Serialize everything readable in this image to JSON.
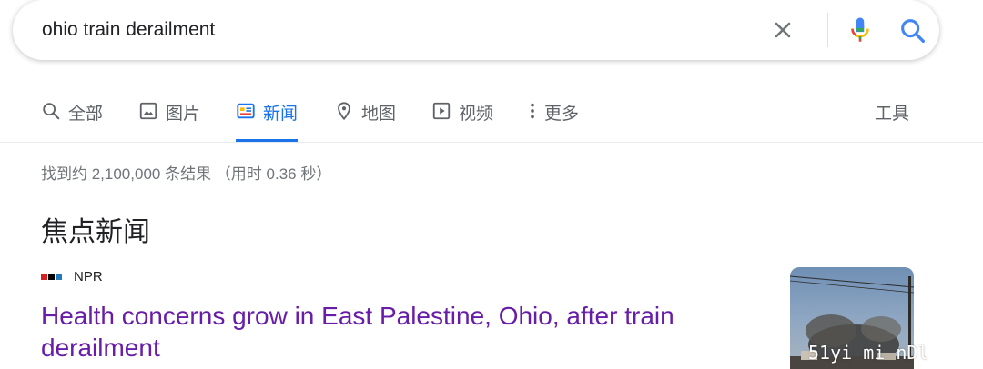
{
  "search": {
    "query": "ohio train derailment",
    "clear_icon": "close-icon",
    "mic_icon": "microphone-icon",
    "search_icon": "search-icon"
  },
  "tabs": [
    {
      "label": "全部",
      "icon": "search-icon"
    },
    {
      "label": "图片",
      "icon": "image-icon"
    },
    {
      "label": "新闻",
      "icon": "news-icon",
      "active": true
    },
    {
      "label": "地图",
      "icon": "map-pin-icon"
    },
    {
      "label": "视频",
      "icon": "video-icon"
    },
    {
      "label": "更多",
      "icon": "more-vertical-icon"
    }
  ],
  "tools_label": "工具",
  "result_stats": "找到约 2,100,000 条结果 （用时 0.36 秒）",
  "top_stories": {
    "heading": "焦点新闻",
    "items": [
      {
        "source": "NPR",
        "headline": "Health concerns grow in East Palestine, Ohio, after train derailment"
      }
    ]
  },
  "watermark": "51yi mi nDl",
  "colors": {
    "accent": "#1a73e8",
    "visited_link": "#681da8",
    "muted_text": "#70757a",
    "tab_text": "#5f6368"
  }
}
